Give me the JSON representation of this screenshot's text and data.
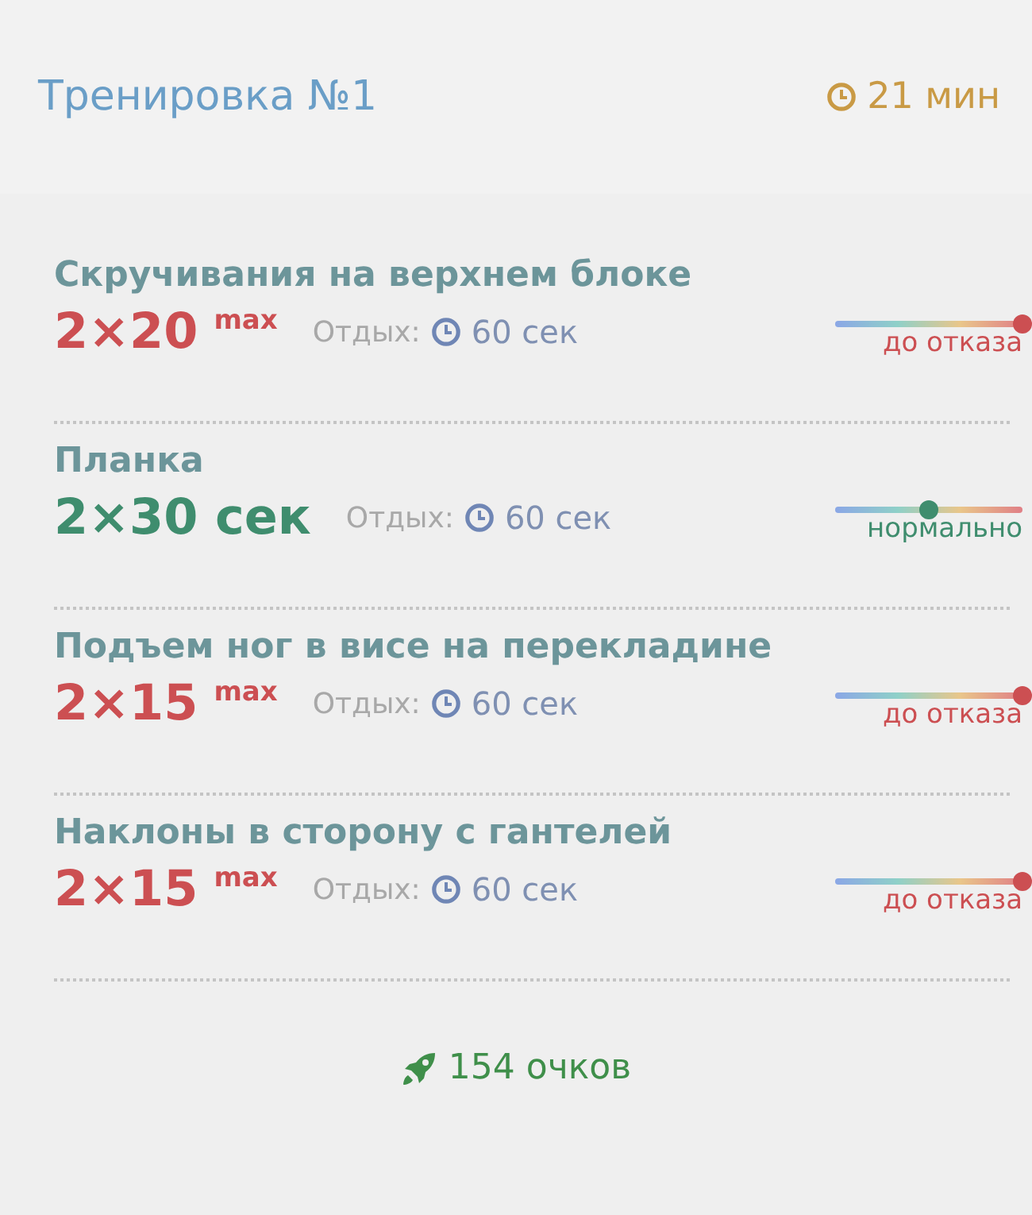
{
  "header": {
    "title": "Тренировка №1",
    "duration": "21 мин"
  },
  "exercises": [
    {
      "name": "Скручивания на верхнем блоке",
      "sets": "2×20",
      "suffix": "max",
      "rest_label": "Отдых:",
      "rest": "60 сек",
      "kind": "max",
      "level": 1,
      "intensity": "до отказа"
    },
    {
      "name": "Планка",
      "sets": "2×30 сек",
      "rest_label": "Отдых:",
      "rest": "60 сек",
      "kind": "normal",
      "level": 0.5,
      "intensity": "нормально"
    },
    {
      "name": "Подъем ног в висе на перекладине",
      "sets": "2×15",
      "suffix": "max",
      "rest_label": "Отдых:",
      "rest": "60 сек",
      "kind": "max",
      "level": 1,
      "intensity": "до отказа"
    },
    {
      "name": "Наклоны в сторону с гантелей",
      "sets": "2×15",
      "suffix": "max",
      "rest_label": "Отдых:",
      "rest": "60 сек",
      "kind": "max",
      "level": 1,
      "intensity": "до отказа"
    }
  ],
  "score": "154 очков"
}
